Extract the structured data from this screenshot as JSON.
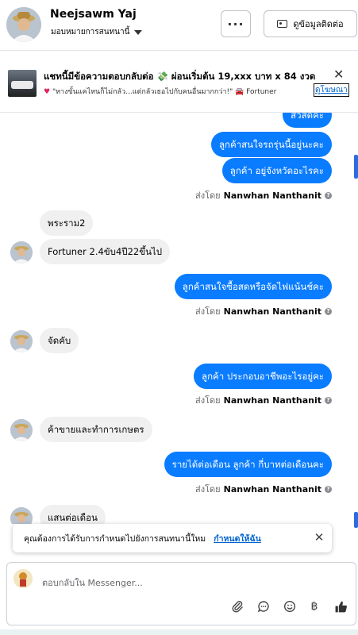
{
  "header": {
    "name": "Neejsawm Yaj",
    "assign_label": "มอบหมายการสนทนานี้",
    "contact_button": "ดูข้อมูลติดต่อ"
  },
  "ad": {
    "title": "แชทนี้มีข้อความตอบกลับต่อ 💸 ผ่อนเริ่มต้น 19,xxx บาท x 84 งวด",
    "subtitle": "\"ทางขั้นแคไหนก็ไม่กลัว...แต่กลัวเธอไปกับคนอื่นมากกว่า!\" 🚘 Fortuner",
    "link": "ดูโฆษณา"
  },
  "messages": {
    "m0": "สวัสดีค่ะ",
    "m1": "ลูกค้าสนใจรถรุ่นนี้อยู่นะคะ",
    "m2": "ลูกค้า อยู่จังหวัดอะไรคะ",
    "m3": "พระราม2",
    "m4": "Fortuner 2.4ขับ4ปี22ขึ้นไป",
    "m5": "ลูกค้าสนใจซื้อสดหรือจัดไฟแน้นช์คะ",
    "m6": "จัดคับ",
    "m7": "ลูกค้า ประกอบอาชีพอะไรอยู่คะ",
    "m8": "ค้าขายและทำการเกษตร",
    "m9": "รายได้ต่อเดือน ลูกค้า กี่บาทต่อเดือนคะ",
    "m10": "แสนต่อเดือน"
  },
  "sent_by": {
    "prefix": "ส่งโดย",
    "agent": "Nanwhan Nanthanit"
  },
  "toast": {
    "text": "คุณต้องการได้รับการกำหนดไปยังการสนทนานี้ใหม",
    "action": "กำหนดให้ฉัน"
  },
  "composer": {
    "placeholder": "ตอบกลับใน Messenger..."
  },
  "colors": {
    "outgoing_bubble": "#0a7cff",
    "incoming_bubble": "#f0f0f0",
    "link": "#0064d1"
  },
  "icons": {
    "more": "more-horizontal-icon",
    "contact": "id-card-icon",
    "close": "close-icon",
    "attach": "paperclip-icon",
    "chat": "chat-bubble-icon",
    "emoji": "smiley-icon",
    "currency": "baht-icon",
    "like": "thumbs-up-icon"
  }
}
